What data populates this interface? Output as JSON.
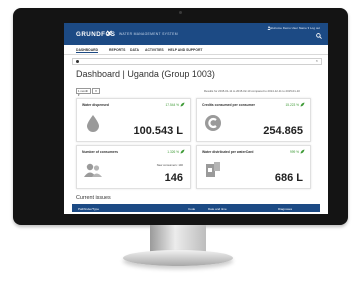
{
  "app": {
    "brand": "GRUNDFOS",
    "subtitle": "WATER MANAGEMENT SYSTEM",
    "user": "Welcome Demo User Name ▾   Log out"
  },
  "nav": [
    "DASHBOARD",
    "REPORTS",
    "DATA",
    "ACTIVITIES",
    "HELP AND SUPPORT"
  ],
  "dashboard": {
    "title": "Dashboard | Uganda (Group 1003)",
    "range_select": "1 month ▾",
    "range_button": "▾",
    "period_text": "Results for 2015-01-11 to 2015-02-10 compared to 2014-12-11 to 2015-01-10"
  },
  "cards": [
    {
      "label": "Water dispensed",
      "change": "17.544 %",
      "value": "100.543 L",
      "icon": "water-drop-icon"
    },
    {
      "label": "Credits consumed per consumer",
      "change": "15.223 %",
      "value": "254.865",
      "icon": "credit-coin-icon"
    },
    {
      "label": "Number of consumers",
      "change": "1.326 %",
      "note": "New consumers: 146",
      "value": "146",
      "icon": "consumers-icon"
    },
    {
      "label": "Water distributed per waterCard",
      "change": "999 %",
      "value": "686 L",
      "icon": "watercard-icon"
    }
  ],
  "issues": {
    "title": "Current issues",
    "columns": [
      "Pathfinder/Type",
      "Code",
      "Date and time",
      "Diagnoses"
    ]
  },
  "colors": {
    "primary": "#1c4a84",
    "positive": "#3d9a35",
    "icon_gray": "#9a9a9a"
  }
}
